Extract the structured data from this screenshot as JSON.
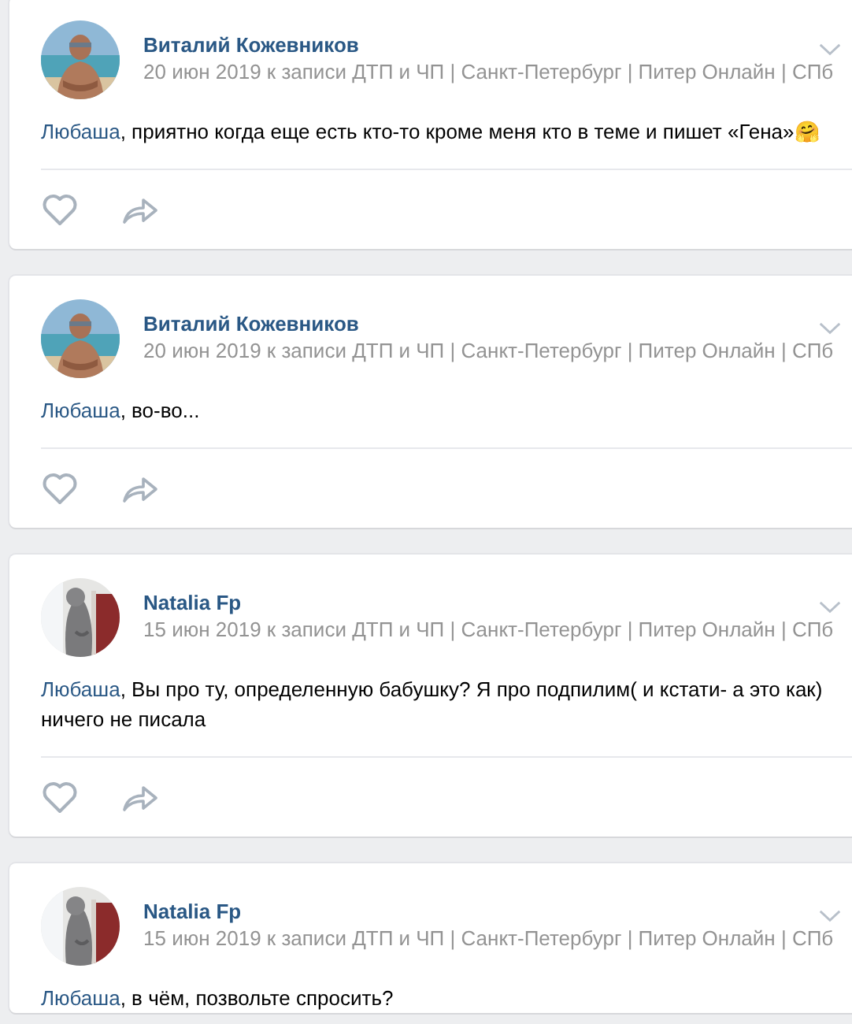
{
  "comments": [
    {
      "author": "Виталий Кожевников",
      "meta": "20 июн 2019 к записи ДТП и ЧП | Санкт-Петербург | Питер Онлайн | СПб",
      "mention": "Любаша",
      "text": ", приятно когда еще есть кто-то кроме меня кто в теме и пишет «Гена»🤗",
      "actions": true
    },
    {
      "author": "Виталий Кожевников",
      "meta": "20 июн 2019 к записи ДТП и ЧП | Санкт-Петербург | Питер Онлайн | СПб",
      "mention": "Любаша",
      "text": ", во-во...",
      "actions": true
    },
    {
      "author": "Natalia Fp",
      "meta": "15 июн 2019 к записи ДТП и ЧП | Санкт-Петербург | Питер Онлайн | СПб",
      "mention": "Любаша",
      "text": ", Вы про ту, определенную бабушку? Я про подпилим( и кстати- а это как) ничего не писала",
      "actions": true
    },
    {
      "author": "Natalia Fp",
      "meta": "15 июн 2019 к записи ДТП и ЧП | Санкт-Петербург | Питер Онлайн | СПб",
      "mention": "Любаша",
      "text": ", в чём, позвольте спросить?",
      "actions": false
    }
  ]
}
